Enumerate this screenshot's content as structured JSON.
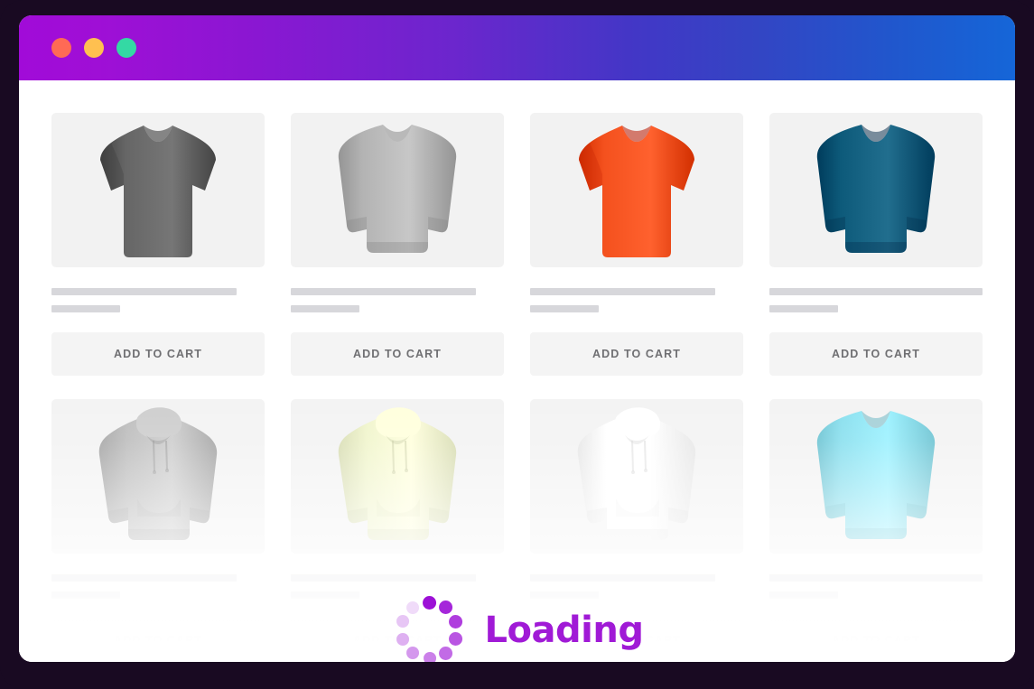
{
  "window": {
    "titlebar": {
      "gradient_from": "#a10bd8",
      "gradient_to": "#1566d8",
      "traffic_lights": [
        {
          "name": "close",
          "color": "#ff6a55"
        },
        {
          "name": "minimize",
          "color": "#ffc050"
        },
        {
          "name": "maximize",
          "color": "#34d9a4"
        }
      ]
    },
    "frame_color": "#190a22",
    "background": "#ffffff"
  },
  "loader": {
    "label": "Loading",
    "text_color": "#a01ad6",
    "spinner_color": "#9c10d6",
    "spinner_dots": 10
  },
  "grid": {
    "columns": 4,
    "cta_label": "ADD TO CART",
    "placeholder_color": "#d7d7db",
    "thumb_background": "#f2f2f2",
    "cta_background": "#f4f4f4",
    "products": [
      {
        "garment": "t-shirt",
        "color": "#666666",
        "color_name": "charcoal-grey",
        "title_bar_width": "87%",
        "meta_bar_width": "32%",
        "faded": false
      },
      {
        "garment": "sweatshirt",
        "color": "#b3b3b3",
        "color_name": "heather-grey",
        "title_bar_width": "87%",
        "meta_bar_width": "32%",
        "faded": false
      },
      {
        "garment": "t-shirt",
        "color": "#f4511e",
        "color_name": "orange",
        "title_bar_width": "87%",
        "meta_bar_width": "32%",
        "faded": false
      },
      {
        "garment": "sweatshirt",
        "color": "#0d5a7a",
        "color_name": "petrol-blue",
        "title_bar_width": "100%",
        "meta_bar_width": "32%",
        "faded": false
      },
      {
        "garment": "hoodie",
        "color": "#b8b8b8",
        "color_name": "grey",
        "title_bar_width": "87%",
        "meta_bar_width": "32%",
        "faded": true
      },
      {
        "garment": "hoodie",
        "color": "#eff4c8",
        "color_name": "pale-yellow",
        "title_bar_width": "87%",
        "meta_bar_width": "32%",
        "faded": true
      },
      {
        "garment": "hoodie",
        "color": "#ffffff",
        "color_name": "white",
        "title_bar_width": "87%",
        "meta_bar_width": "32%",
        "faded": true
      },
      {
        "garment": "sweatshirt",
        "color": "#7fdcec",
        "color_name": "cyan",
        "title_bar_width": "100%",
        "meta_bar_width": "32%",
        "faded": true
      }
    ]
  }
}
